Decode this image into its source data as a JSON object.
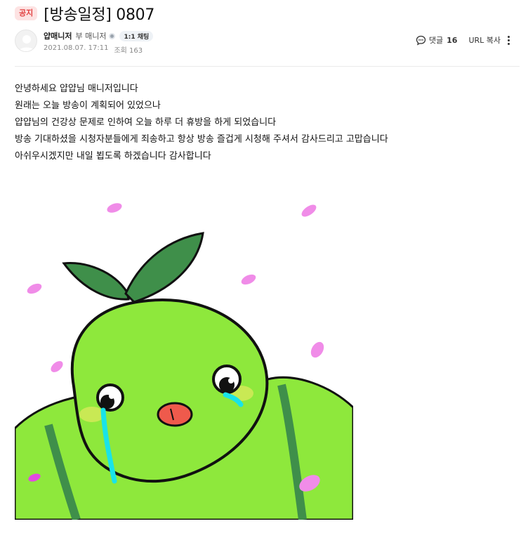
{
  "header": {
    "badge": "공지",
    "title": "[방송일정] 0807"
  },
  "author": {
    "name": "얍매니저",
    "role": "부 매니저",
    "chat_label": "1:1 채팅",
    "date": "2021.08.07. 17:11",
    "views": "조회 163"
  },
  "actions": {
    "comment_label": "댓글",
    "comment_count": "16",
    "url_copy_label": "URL 복사"
  },
  "body": {
    "lines": [
      "안녕하세요 얍얍님 매니저입니다",
      "원래는 오늘 방송이 계획되어 있었으나",
      "얍얍님의 건강상 문제로 인하여 오늘 하루 더 휴방을 하게 되었습니다",
      "방송 기대하셨을 시청자분들에게 죄송하고 항상 방송 즐겁게 시청해 주셔서 감사드리고 고맙습니다",
      "아쉬우시겠지만 내일 뵙도록 하겠습니다 감사합니다"
    ]
  },
  "colors": {
    "badge_bg": "#fde3e3",
    "badge_text": "#e24242",
    "character_green": "#8ee83c",
    "leaf_green": "#3f8f4a",
    "petal_pink": "#f08ce8",
    "tear_cyan": "#19e3e8"
  }
}
